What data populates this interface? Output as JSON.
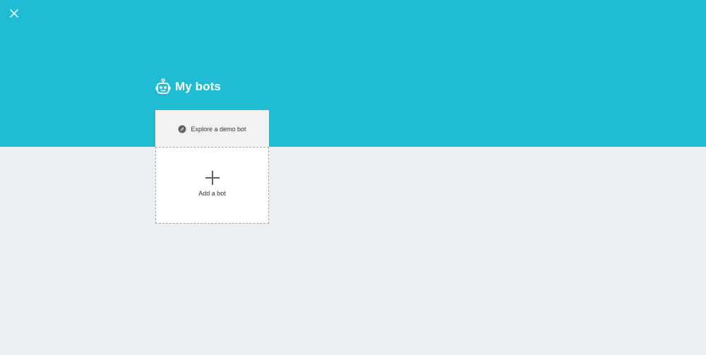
{
  "colors": {
    "header_bg": "#20bcd3",
    "page_bg": "#ebeff2",
    "demo_card_bg": "#f2f2f2",
    "add_card_bg": "#ffffff",
    "text_dark": "#333333",
    "icon_gray": "#5f6368"
  },
  "header": {
    "close_icon": "close-icon",
    "title_icon": "robot-icon",
    "title": "My bots"
  },
  "demo_card": {
    "icon": "compass-icon",
    "label": "Explore a demo bot"
  },
  "add_card": {
    "icon": "plus-icon",
    "label": "Add a bot"
  }
}
